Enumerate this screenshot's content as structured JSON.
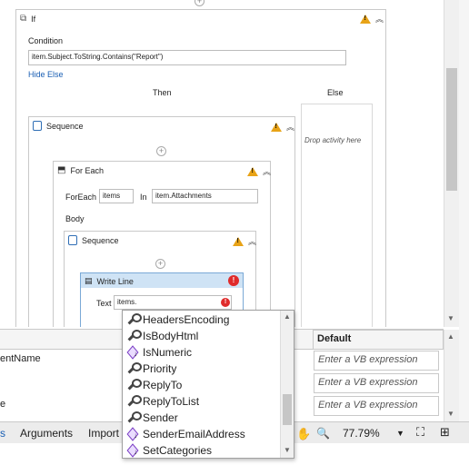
{
  "if_activity": {
    "title": "If",
    "condition_label": "Condition",
    "condition_value": "item.Subject.ToString.Contains(\"Report\")",
    "hide_else": "Hide Else",
    "then_label": "Then",
    "else_label": "Else",
    "drop_hint": "Drop activity here"
  },
  "sequence_outer": {
    "title": "Sequence"
  },
  "for_each": {
    "title": "For Each",
    "foreach_label": "ForEach",
    "foreach_value": "items",
    "in_label": "In",
    "in_value": "item.Attachments",
    "body_label": "Body"
  },
  "sequence_inner": {
    "title": "Sequence"
  },
  "write_line": {
    "title": "Write Line",
    "text_label": "Text",
    "text_value": "items."
  },
  "variables_grid": {
    "header_default": "Default",
    "rows": [
      {
        "name": "entName",
        "default_placeholder": "Enter a VB expression"
      },
      {
        "name": "",
        "default_placeholder": "Enter a VB expression"
      },
      {
        "name": "e",
        "default_placeholder": "Enter a VB expression"
      }
    ]
  },
  "bottom_bar": {
    "tab_variables_fragment": "s",
    "tab_arguments": "Arguments",
    "tab_imports": "Import",
    "zoom": "77.79%"
  },
  "intellisense": {
    "items": [
      {
        "label": "HeadersEncoding",
        "icon": "wrench-icon"
      },
      {
        "label": "IsBodyHtml",
        "icon": "wrench-icon"
      },
      {
        "label": "IsNumeric",
        "icon": "method-ext-icon"
      },
      {
        "label": "Priority",
        "icon": "wrench-icon"
      },
      {
        "label": "ReplyTo",
        "icon": "wrench-icon"
      },
      {
        "label": "ReplyToList",
        "icon": "wrench-icon"
      },
      {
        "label": "Sender",
        "icon": "wrench-icon"
      },
      {
        "label": "SenderEmailAddress",
        "icon": "method-ext-icon"
      },
      {
        "label": "SetCategories",
        "icon": "method-ext-icon"
      }
    ]
  },
  "colors": {
    "warning": "#e8a317",
    "error": "#e02b2b",
    "link": "#1a5fb4",
    "selected_activity_header": "#cfe3f5"
  }
}
